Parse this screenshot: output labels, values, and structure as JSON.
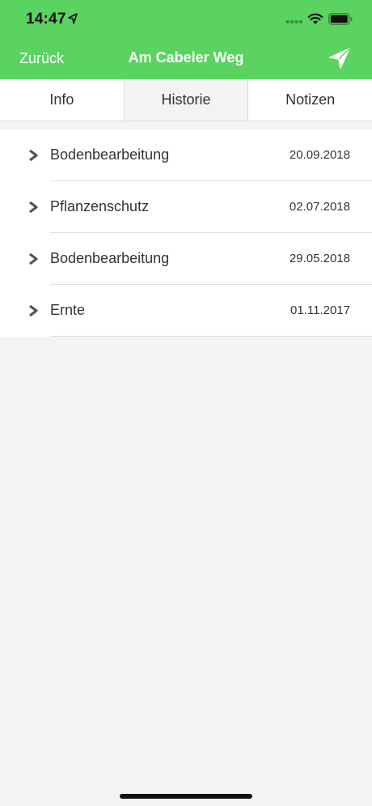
{
  "status_bar": {
    "time": "14:47",
    "icons": [
      "location-arrow-icon",
      "cellular-signal-icon",
      "wifi-icon",
      "battery-icon"
    ]
  },
  "nav": {
    "back_label": "Zurück",
    "title": "Am Cabeler Weg",
    "action_icon": "location-arrow-icon"
  },
  "tabs": [
    {
      "label": "Info",
      "active": false
    },
    {
      "label": "Historie",
      "active": true
    },
    {
      "label": "Notizen",
      "active": false
    }
  ],
  "history": [
    {
      "title": "Bodenbearbeitung",
      "date": "20.09.2018"
    },
    {
      "title": "Pflanzenschutz",
      "date": "02.07.2018"
    },
    {
      "title": "Bodenbearbeitung",
      "date": "29.05.2018"
    },
    {
      "title": "Ernte",
      "date": "01.11.2017"
    }
  ],
  "colors": {
    "header_green": "#5ad361",
    "background": "#f4f4f4",
    "text": "#333333"
  }
}
